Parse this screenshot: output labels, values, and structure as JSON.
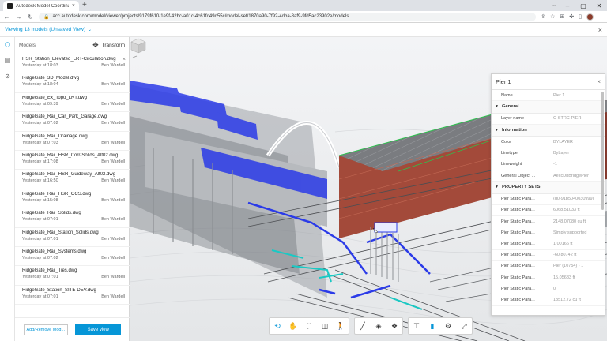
{
  "browser": {
    "tab_title": "Autodesk Model Coordination",
    "url": "acc.autodesk.com/model/viewer/projects/9179f610-1e9f-42bc-a01c-4c61fd49d55c/model-set/1870a90-7f92-4dba-8af9-9fd5ac23902e/models"
  },
  "header": {
    "view_title": "Viewing 13 models (Unsaved View)"
  },
  "panel": {
    "title": "Models",
    "transform_label": "Transform",
    "add_remove_label": "Add/Remove Mod...",
    "save_view_label": "Save view",
    "models": [
      {
        "name": "HSR_Station_Elevated_LRT-Circulation.dwg",
        "date": "Yesterday at 18:03",
        "author": "Ben Wardell"
      },
      {
        "name": "RidgeGate_3D_Model.dwg",
        "date": "Yesterday at 18:04",
        "author": "Ben Wardell"
      },
      {
        "name": "RidgeGate_Ex_Topo_LRT.dwg",
        "date": "Yesterday at 09:39",
        "author": "Ben Wardell"
      },
      {
        "name": "RidgeGate_Rail_Car_Park_Garage.dwg",
        "date": "Yesterday at 07:02",
        "author": "Ben Wardell"
      },
      {
        "name": "RidgeGate_Rail_Drainage.dwg",
        "date": "Yesterday at 07:03",
        "author": "Ben Wardell"
      },
      {
        "name": "RidgeGate_Rail_HSR_Corr-Solids_Alt02.dwg",
        "date": "Yesterday at 17:08",
        "author": "Ben Wardell"
      },
      {
        "name": "RidgeGate_Rail_HSR_Guideway_Alt02.dwg",
        "date": "Yesterday at 16:50",
        "author": "Ben Wardell"
      },
      {
        "name": "RidgeGate_Rail_HSR_OCS.dwg",
        "date": "Yesterday at 15:08",
        "author": "Ben Wardell"
      },
      {
        "name": "RidgeGate_Rail_Solids.dwg",
        "date": "Yesterday at 07:01",
        "author": "Ben Wardell"
      },
      {
        "name": "RidgeGate_Rail_Station_Solids.dwg",
        "date": "Yesterday at 07:01",
        "author": "Ben Wardell"
      },
      {
        "name": "RidgeGate_Rail_Systems.dwg",
        "date": "Yesterday at 07:02",
        "author": "Ben Wardell"
      },
      {
        "name": "RidgeGate_Rail_Ties.dwg",
        "date": "Yesterday at 07:01",
        "author": "Ben Wardell"
      },
      {
        "name": "RidgeGate_Station_SITE-DEV.dwg",
        "date": "Yesterday at 07:01",
        "author": "Ben Wardell"
      }
    ]
  },
  "properties": {
    "title": "Pier 1",
    "name_key": "Name",
    "name_value": "Pier 1",
    "general_label": "General",
    "layer_key": "Layer name",
    "layer_value": "C-STRC-PIER",
    "information_label": "Information",
    "info_rows": [
      {
        "k": "Color",
        "v": "BYLAYER"
      },
      {
        "k": "Linetype",
        "v": "ByLayer"
      },
      {
        "k": "Lineweight",
        "v": "-1"
      },
      {
        "k": "General Object ...",
        "v": "AeccDbBridgePier"
      }
    ],
    "property_sets_label": "PROPERTY SETS",
    "pset_rows": [
      {
        "k": "Pier Static Para...",
        "v": "{d0-91b5040030999}"
      },
      {
        "k": "Pier Static Para...",
        "v": "6068.51033 ft"
      },
      {
        "k": "Pier Static Para...",
        "v": "2148.07080 cu ft"
      },
      {
        "k": "Pier Static Para...",
        "v": "Simply supported"
      },
      {
        "k": "Pier Static Para...",
        "v": "1.00166 ft"
      },
      {
        "k": "Pier Static Para...",
        "v": "-60.80742 ft"
      },
      {
        "k": "Pier Static Para...",
        "v": "Pier (10754) - 1"
      },
      {
        "k": "Pier Static Para...",
        "v": "15.05683 ft"
      },
      {
        "k": "Pier Static Para...",
        "v": "0"
      },
      {
        "k": "Pier Static Para...",
        "v": "13512.72 cu ft"
      }
    ]
  },
  "colors": {
    "accent": "#0696d7",
    "selection_blue": "#2b3be8",
    "highlight_cyan": "#19c9c4"
  }
}
